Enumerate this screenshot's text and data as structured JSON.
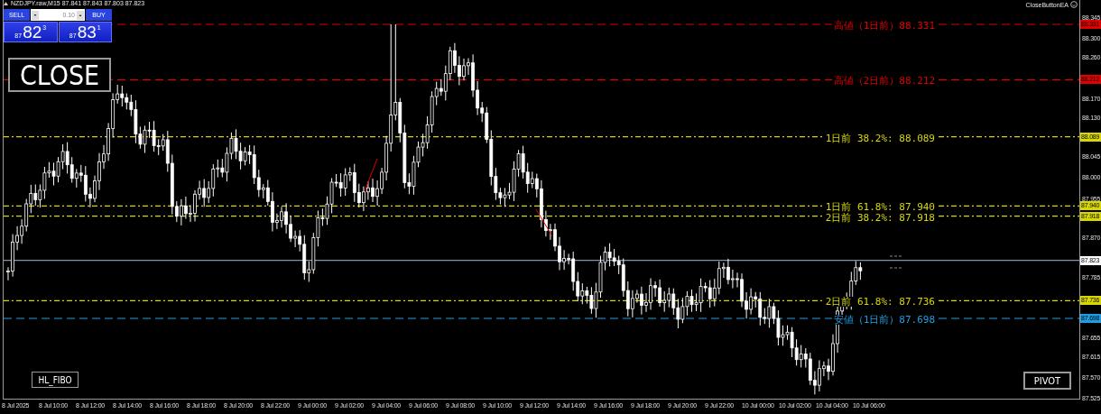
{
  "chart": {
    "symbol_info": "NZDJPY.raw,M15  87.841 87.843 87.803 87.823",
    "expert": "CloseButtonEA"
  },
  "trade_panel": {
    "sell_label": "SELL",
    "buy_label": "BUY",
    "lot": "0.10",
    "sell_price": {
      "big": "87",
      "main": "82",
      "sup": "3"
    },
    "buy_price": {
      "big": "87",
      "main": "83",
      "sup": "1"
    }
  },
  "buttons": [
    {
      "label": "CLOSE",
      "kind": "close"
    },
    {
      "label": "HL_FIBO",
      "kind": "fibo"
    },
    {
      "label": "PIVOT",
      "kind": "pivot"
    }
  ],
  "levels": [
    {
      "kind": "dashed",
      "label": "高値（1日前）88.331",
      "tag": "88.331",
      "color": "#e00000"
    },
    {
      "kind": "dashed",
      "label": "高値（2日前）88.212",
      "tag": "88.212",
      "color": "#e00000"
    },
    {
      "kind": "dashdot",
      "label": "1日前 38.2%: 88.089",
      "tag": "88.089",
      "color": "#d8d800"
    },
    {
      "kind": "dashdot",
      "label": "1日前 61.8%: 87.940",
      "tag": "87.940",
      "color": "#d8d800"
    },
    {
      "kind": "dashdot",
      "label": "2日前 38.2%: 87.918",
      "tag": "87.918",
      "color": "#d8d800"
    },
    {
      "kind": "bid",
      "tag": "87.823",
      "color": "#ffffff"
    },
    {
      "kind": "dashdot",
      "label": "2日前 61.8%: 87.736",
      "tag": "87.736",
      "color": "#d8d800"
    },
    {
      "kind": "dashed",
      "label": "安値（1日前）87.698",
      "tag": "87.698",
      "color": "#1e9ee0"
    }
  ],
  "price_axis": {
    "ticks": [
      "88.345",
      "88.300",
      "88.260",
      "88.170",
      "88.130",
      "88.045",
      "88.000",
      "87.955",
      "87.870",
      "87.785",
      "87.655",
      "87.615",
      "87.570",
      "87.525"
    ]
  },
  "time_axis": {
    "ticks": [
      "8 Jul 2025",
      "8 Jul 10:00",
      "8 Jul 12:00",
      "8 Jul 14:00",
      "8 Jul 16:00",
      "8 Jul 18:00",
      "8 Jul 20:00",
      "8 Jul 22:00",
      "9 Jul 00:00",
      "9 Jul 02:00",
      "9 Jul 04:00",
      "9 Jul 06:00",
      "9 Jul 08:00",
      "9 Jul 10:00",
      "9 Jul 12:00",
      "9 Jul 14:00",
      "9 Jul 16:00",
      "9 Jul 18:00",
      "9 Jul 20:00",
      "9 Jul 22:00",
      "10 Jul 00:00",
      "10 Jul 02:00",
      "10 Jul 04:00",
      "10 Jul 06:00"
    ]
  }
}
